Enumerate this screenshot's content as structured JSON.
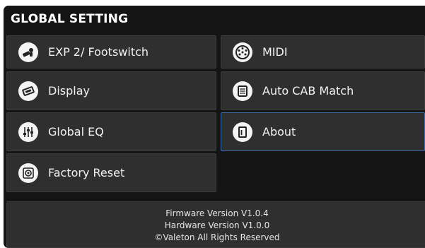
{
  "header": {
    "title": "GLOBAL SETTING"
  },
  "menu": {
    "items": [
      {
        "label": "EXP 2/ Footswitch",
        "icon": "footswitch-icon"
      },
      {
        "label": "MIDI",
        "icon": "midi-icon"
      },
      {
        "label": "Display",
        "icon": "display-icon"
      },
      {
        "label": "Auto CAB Match",
        "icon": "cab-icon"
      },
      {
        "label": "Global EQ",
        "icon": "eq-sliders-icon"
      },
      {
        "label": "About",
        "icon": "about-icon",
        "selected": true
      },
      {
        "label": "Factory Reset",
        "icon": "reset-icon"
      }
    ]
  },
  "footer": {
    "firmware": "Firmware Version V1.0.4",
    "hardware": "Hardware Version V1.0.0",
    "copyright": "©Valeton All Rights Reserved"
  },
  "colors": {
    "background": "#141414",
    "tile": "#2f2f2f",
    "selected_border": "#3c6fb0",
    "text": "#f2f2f2"
  }
}
